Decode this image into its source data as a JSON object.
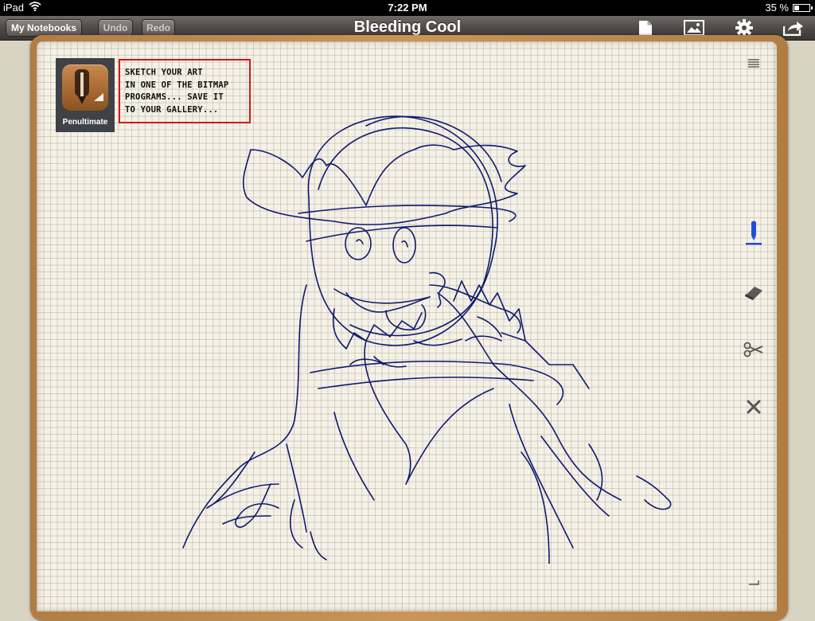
{
  "status_bar": {
    "device": "iPad",
    "time": "7:22 PM",
    "battery": "35 %",
    "battery_level": 0.35
  },
  "toolbar": {
    "notebooks_label": "My Notebooks",
    "undo_label": "Undo",
    "redo_label": "Redo",
    "title": "Bleeding Cool"
  },
  "canvas": {
    "app_icon_label": "Penultimate",
    "caption_lines": [
      "SKETCH YOUR ART",
      "IN ONE OF THE BITMAP",
      "PROGRAMS... SAVE IT",
      "TO YOUR GALLERY..."
    ]
  },
  "colors": {
    "ink": "#0f1a70",
    "pen_tool": "#1f4fd6",
    "caption_border": "#d21818"
  }
}
